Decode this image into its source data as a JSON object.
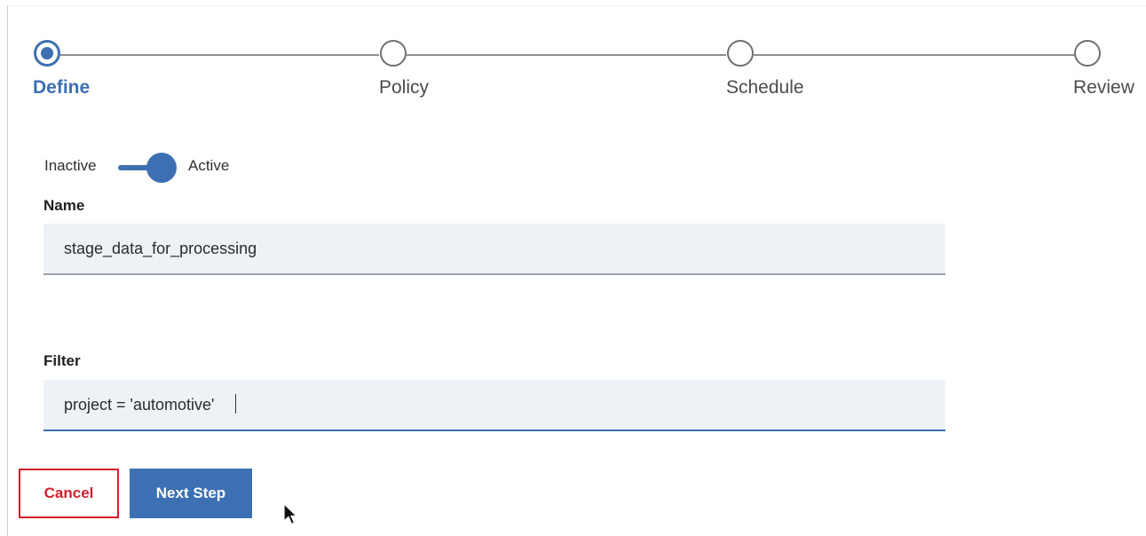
{
  "stepper": {
    "steps": [
      {
        "label": "Define",
        "state": "active"
      },
      {
        "label": "Policy",
        "state": "incomplete"
      },
      {
        "label": "Schedule",
        "state": "incomplete"
      },
      {
        "label": "Review",
        "state": "incomplete"
      }
    ]
  },
  "status_toggle": {
    "off_label": "Inactive",
    "on_label": "Active",
    "value": "Active"
  },
  "form": {
    "name": {
      "label": "Name",
      "value": "stage_data_for_processing"
    },
    "filter": {
      "label": "Filter",
      "value": "project = 'automotive'"
    }
  },
  "actions": {
    "cancel_label": "Cancel",
    "next_label": "Next Step"
  },
  "colors": {
    "accent": "#3d70b2",
    "danger": "#d0212c",
    "field_bg": "#eef2f6"
  },
  "icons": {
    "cursor": "mouse-pointer-icon"
  }
}
